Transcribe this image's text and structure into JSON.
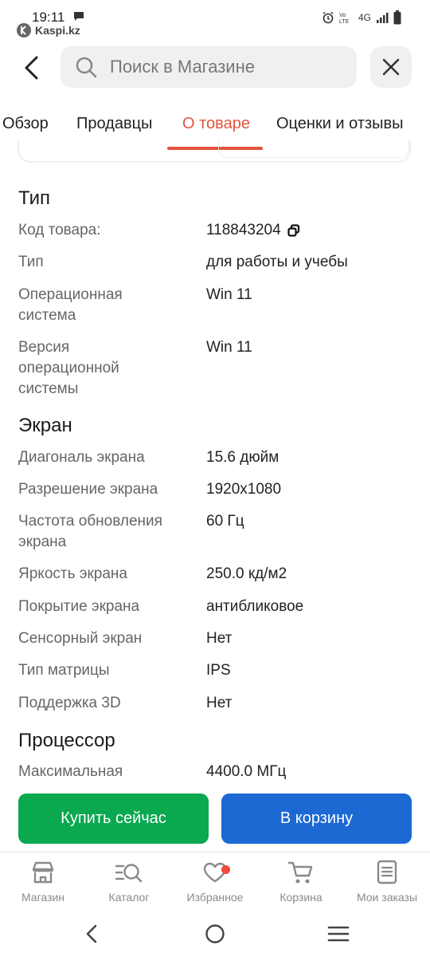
{
  "status_bar": {
    "time": "19:11",
    "app_name": "Kaspi.kz",
    "network": "4G"
  },
  "header": {
    "search_placeholder": "Поиск в Магазине"
  },
  "tabs": [
    {
      "label": "Обзор",
      "active": false
    },
    {
      "label": "Продавцы",
      "active": false
    },
    {
      "label": "О товаре",
      "active": true
    },
    {
      "label": "Оценки и отзывы",
      "active": false
    }
  ],
  "specs": {
    "sections": [
      {
        "title": "Тип"
      },
      {
        "title": "Экран"
      },
      {
        "title": "Процессор"
      }
    ],
    "rows": [
      {
        "label": "Код товара:",
        "value": "118843204"
      },
      {
        "label": "Тип",
        "value": "для работы и учебы"
      },
      {
        "label": "Операционная система",
        "value": "Win 11"
      },
      {
        "label": "Версия операционной системы",
        "value": "Win 11"
      },
      {
        "label": "Диагональ экрана",
        "value": "15.6 дюйм"
      },
      {
        "label": "Разрешение экрана",
        "value": "1920x1080"
      },
      {
        "label": "Частота обновления экрана",
        "value": "60 Гц"
      },
      {
        "label": "Яркость экрана",
        "value": "250.0 кд/м2"
      },
      {
        "label": "Покрытие экрана",
        "value": "антибликовое"
      },
      {
        "label": "Сенсорный экран",
        "value": "Нет"
      },
      {
        "label": "Тип матрицы",
        "value": "IPS"
      },
      {
        "label": "Поддержка 3D",
        "value": "Нет"
      },
      {
        "label": "Максимальная",
        "value": "4400.0 МГц"
      }
    ]
  },
  "actions": {
    "buy_now": "Купить сейчас",
    "add_to_cart": "В корзину"
  },
  "bottom_nav": [
    {
      "label": "Магазин",
      "icon": "store-icon"
    },
    {
      "label": "Каталог",
      "icon": "catalog-search-icon"
    },
    {
      "label": "Избранное",
      "icon": "heart-icon"
    },
    {
      "label": "Корзина",
      "icon": "cart-icon"
    },
    {
      "label": "Мои заказы",
      "icon": "orders-icon"
    }
  ],
  "colors": {
    "accent_tab": "#e2533b",
    "buy_button": "#0aa84f",
    "cart_button": "#1c69d4",
    "badge_dot": "#f0493e"
  }
}
